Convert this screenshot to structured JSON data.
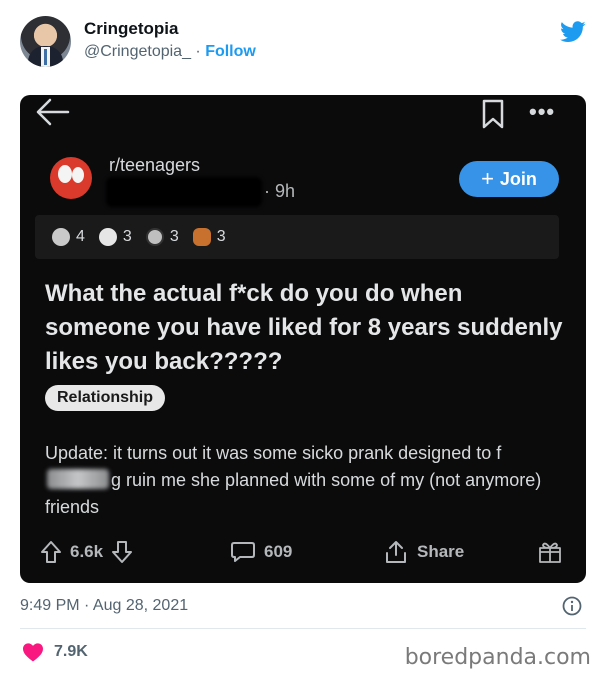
{
  "tweet": {
    "display_name": "Cringetopia",
    "handle": "@Cringetopia_",
    "separator": " · ",
    "follow_label": "Follow",
    "timestamp": "9:49 PM · Aug 28, 2021",
    "like_count": "7.9K"
  },
  "embedded_post": {
    "subreddit": "r/teenagers",
    "time": "· 9h",
    "join_label": "Join",
    "awards": [
      {
        "icon": "award-icon",
        "count": "4"
      },
      {
        "icon": "award-icon",
        "count": "3"
      },
      {
        "icon": "award-icon",
        "count": "3"
      },
      {
        "icon": "award-icon",
        "count": "3"
      }
    ],
    "title": "What the actual f*ck do you do when someone you have liked for 8 years suddenly likes you back?????",
    "flair": "Relationship",
    "body_before": "Update: it turns out it was some sicko prank designed to f",
    "body_after": "g ruin me she planned with some of my (not anymore) friends",
    "votes": "6.6k",
    "comments": "609",
    "share_label": "Share"
  },
  "watermark": "boredpanda.com",
  "colors": {
    "twitter_blue": "#1d9bf0",
    "reddit_join_blue": "#3793e8",
    "like_pink": "#f91880",
    "dark_bg": "#0b0b0c"
  }
}
